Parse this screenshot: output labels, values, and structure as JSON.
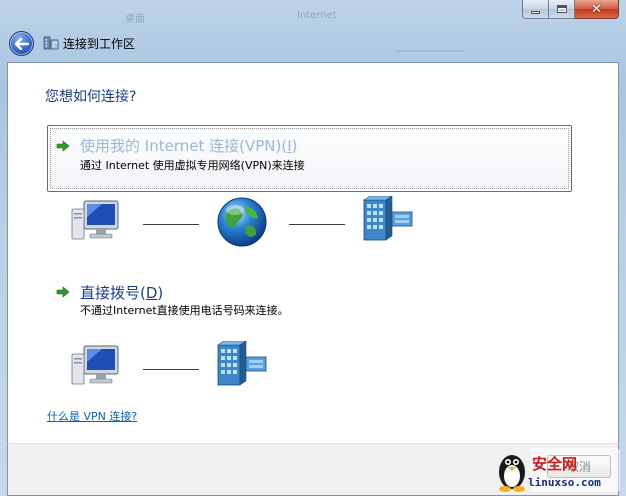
{
  "window": {
    "title": "连接到工作区",
    "background_blur": [
      "桌面",
      "Internet"
    ]
  },
  "content": {
    "heading": "您想如何连接?",
    "options": [
      {
        "title_prefix": "使用我的 Internet 连接(VPN)(",
        "access_key": "I",
        "title_suffix": ")",
        "description": "通过 Internet 使用虚拟专用网络(VPN)来连接",
        "selected": true
      },
      {
        "title_prefix": "直接拨号(",
        "access_key": "D",
        "title_suffix": ")",
        "description": "不通过Internet直接使用电话号码来连接。",
        "selected": false
      }
    ],
    "help_link": "什么是 VPN 连接?"
  },
  "footer": {
    "cancel_label": "取消"
  },
  "watermark": {
    "text": "安全网",
    "url": "linuxso.com"
  },
  "colors": {
    "heading": "#1a3e8c",
    "selected_title": "#9eb6d8",
    "link": "#0d5fb8",
    "arrow": "#2e9a2e"
  },
  "icons": {
    "back": "back-arrow-icon",
    "title": "network-workplace-icon",
    "option_arrow": "green-arrow-icon",
    "computer": "computer-icon",
    "internet": "globe-icon",
    "network": "server-building-icon"
  }
}
